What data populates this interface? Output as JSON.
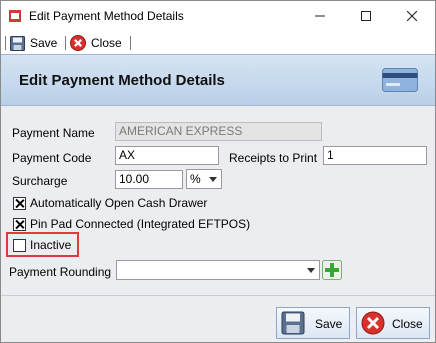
{
  "window": {
    "title": "Edit Payment Method Details"
  },
  "toolbar": {
    "save_label": "Save",
    "close_label": "Close"
  },
  "header": {
    "title": "Edit Payment Method Details"
  },
  "form": {
    "payment_name": {
      "label": "Payment Name",
      "value": "AMERICAN EXPRESS"
    },
    "payment_code": {
      "label": "Payment Code",
      "value": "AX"
    },
    "receipts_to_print": {
      "label": "Receipts to Print",
      "value": "1"
    },
    "surcharge": {
      "label": "Surcharge",
      "value": "10.00",
      "unit": "%"
    },
    "auto_open_cash_drawer": {
      "label": "Automatically Open Cash Drawer",
      "checked": true
    },
    "pin_pad_connected": {
      "label": "Pin Pad Connected (Integrated EFTPOS)",
      "checked": true
    },
    "inactive": {
      "label": "Inactive",
      "checked": false
    },
    "payment_rounding": {
      "label": "Payment Rounding",
      "value": ""
    }
  },
  "buttons": {
    "save": "Save",
    "close": "Close"
  },
  "colors": {
    "header_blue": "#c6d9ee",
    "highlight_red": "#e03b3b",
    "add_green": "#3aa63a",
    "close_red": "#d9302c"
  }
}
